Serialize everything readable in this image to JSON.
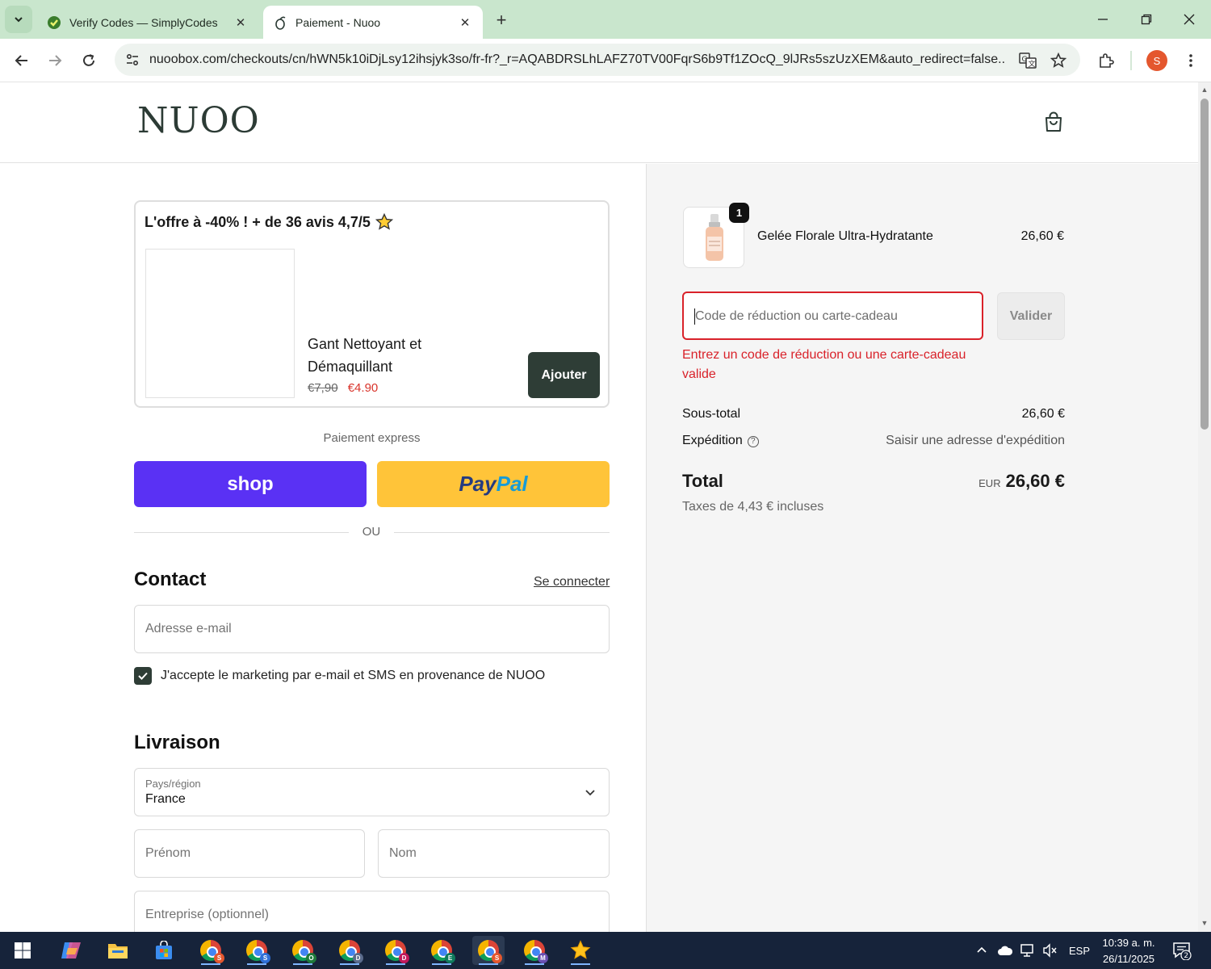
{
  "browser": {
    "tabs": [
      {
        "title": "Verify Codes — SimplyCodes",
        "active": false
      },
      {
        "title": "Paiement - Nuoo",
        "active": true
      }
    ],
    "url": "nuoobox.com/checkouts/cn/hWN5k10iDjLsy12ihsjyk3so/fr-fr?_r=AQABDRSLhLAFZ70TV00FqrS6b9Tf1ZOcQ_9lJRs5szUzXEM&auto_redirect=false...",
    "profile_initial": "S",
    "icons": {
      "back": "arrow-left-icon",
      "forward": "arrow-right-icon",
      "reload": "reload-icon",
      "translate": "translate-icon",
      "bookmark": "star-icon",
      "extensions": "puzzle-icon",
      "menu": "kebab-menu-icon"
    },
    "accent": "#c9e6cd"
  },
  "header": {
    "logo": "NUOO"
  },
  "upsell": {
    "title": "L'offre à -40% ! + de 36 avis 4,7/5",
    "product_name": "Gant Nettoyant et Démaquillant",
    "old_price": "€7,90",
    "new_price": "€4.90",
    "add_label": "Ajouter"
  },
  "express": {
    "label": "Paiement express",
    "shop_label": "shop",
    "paypal_part1": "Pay",
    "paypal_part2": "Pal",
    "or_label": "OU"
  },
  "contact": {
    "title": "Contact",
    "login_link": "Se connecter",
    "email_placeholder": "Adresse e-mail",
    "marketing_label": "J'accepte le marketing par e-mail et SMS en provenance de NUOO",
    "marketing_checked": true
  },
  "delivery": {
    "title": "Livraison",
    "country_label": "Pays/région",
    "country_value": "France",
    "first_name_placeholder": "Prénom",
    "last_name_placeholder": "Nom",
    "company_placeholder": "Entreprise (optionnel)"
  },
  "summary": {
    "item": {
      "name": "Gelée Florale Ultra-Hydratante",
      "price": "26,60 €",
      "quantity": "1"
    },
    "discount_placeholder": "Code de réduction ou carte-cadeau",
    "validate_label": "Valider",
    "error": "Entrez un code de réduction ou une carte-cadeau valide",
    "subtotal_label": "Sous-total",
    "subtotal_value": "26,60 €",
    "shipping_label": "Expédition",
    "shipping_value": "Saisir une adresse d'expédition",
    "total_label": "Total",
    "currency": "EUR",
    "total_value": "26,60 €",
    "taxes": "Taxes de 4,43 € incluses",
    "error_color": "#d9222a"
  },
  "taskbar": {
    "apps": [
      "start",
      "copilot",
      "file-explorer",
      "store",
      "chrome-S",
      "chrome-S",
      "chrome-O",
      "chrome-D",
      "chrome-D",
      "chrome-E",
      "chrome-S",
      "chrome-M",
      "favorites"
    ],
    "chrome_badges": [
      "S",
      "S",
      "O",
      "D",
      "D",
      "E",
      "S",
      "M"
    ],
    "language": "ESP",
    "time": "10:39 a. m.",
    "date": "26/11/2025",
    "notifications": "2"
  }
}
